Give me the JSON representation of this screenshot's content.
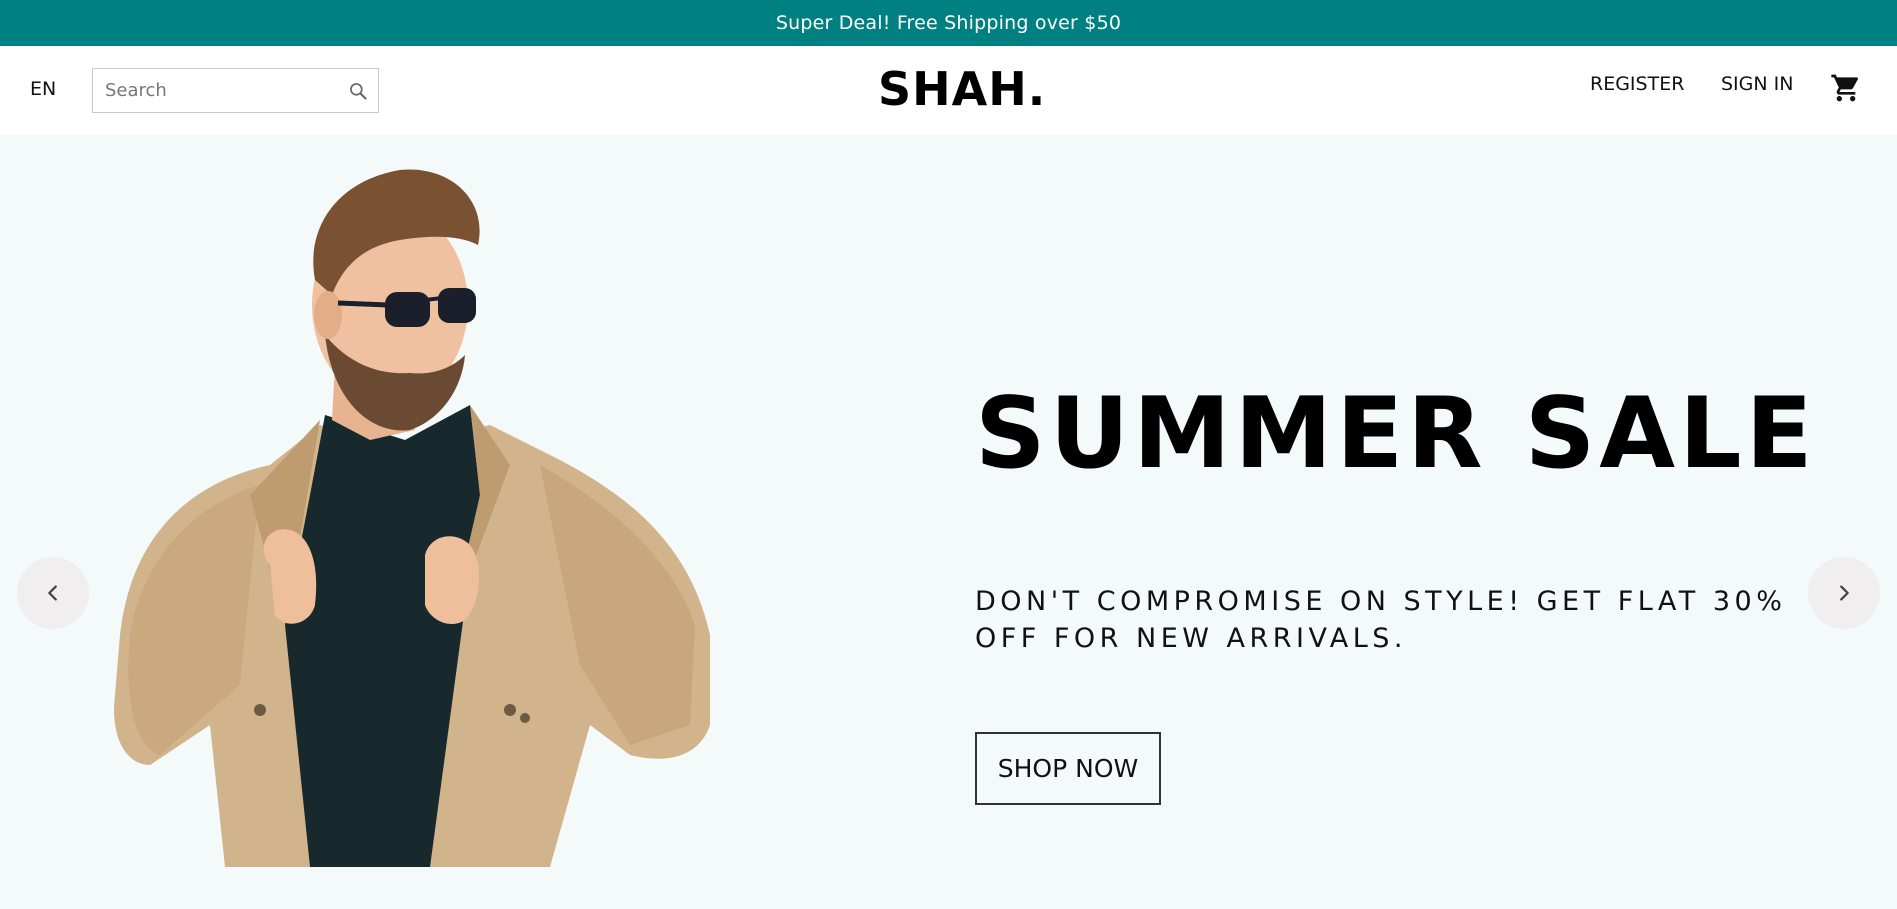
{
  "announcement": {
    "text": "Super Deal! Free Shipping over $50",
    "background": "#008080"
  },
  "navbar": {
    "language": "EN",
    "search": {
      "placeholder": "Search",
      "value": "",
      "icon": "search-icon"
    },
    "logo": "SHAH.",
    "links": {
      "register": "REGISTER",
      "sign_in": "SIGN IN"
    },
    "cart_icon": "cart-icon"
  },
  "hero": {
    "background": "#f4f9fa",
    "title": "SUMMER SALE",
    "description": "DON'T COMPROMISE ON STYLE! GET FLAT 30% OFF FOR NEW ARRIVALS.",
    "cta_label": "SHOP NOW",
    "prev_icon": "chevron-left-icon",
    "next_icon": "chevron-right-icon"
  }
}
